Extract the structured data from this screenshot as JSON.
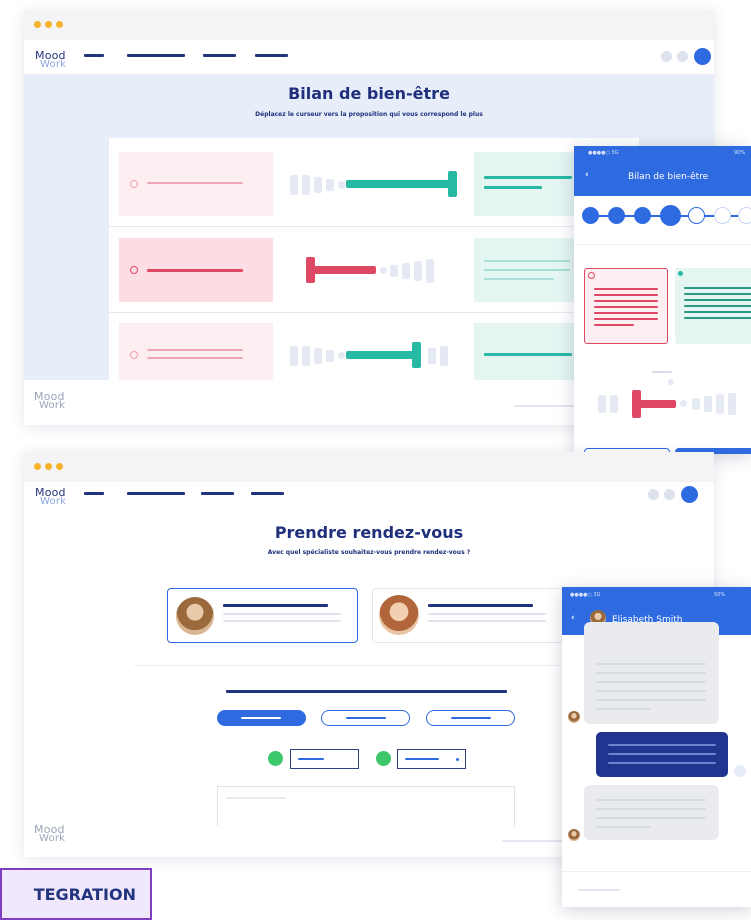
{
  "brand": {
    "line1": "Mood",
    "line2": "Work"
  },
  "screen1": {
    "title": "Bilan de bien-être",
    "subtitle": "Déplacez le curseur vers la proposition qui vous correspond le plus"
  },
  "mobile1": {
    "status_left": "●●●●○ 3G",
    "status_right": "90%",
    "header_title": "Bilan de bien-être",
    "back_icon": "chevron-left-icon"
  },
  "screen2": {
    "title": "Prendre rendez-vous",
    "subtitle": "Avec quel spécialiste souhaitez-vous prendre rendez-vous ?"
  },
  "mobile2": {
    "status_left": "●●●●○ 3G",
    "status_right": "50%",
    "contact_name": "Elisabeth Smith",
    "back_icon": "chevron-left-icon"
  },
  "badge": {
    "label": "TEGRATION"
  },
  "colors": {
    "primary": "#2f6be0",
    "navy": "#1f2f7c",
    "teal": "#27b9a3",
    "red": "#de4865",
    "pink_bg": "#fdeef1",
    "teal_bg": "#e4f5f2",
    "accent": "#7f3fbf"
  }
}
